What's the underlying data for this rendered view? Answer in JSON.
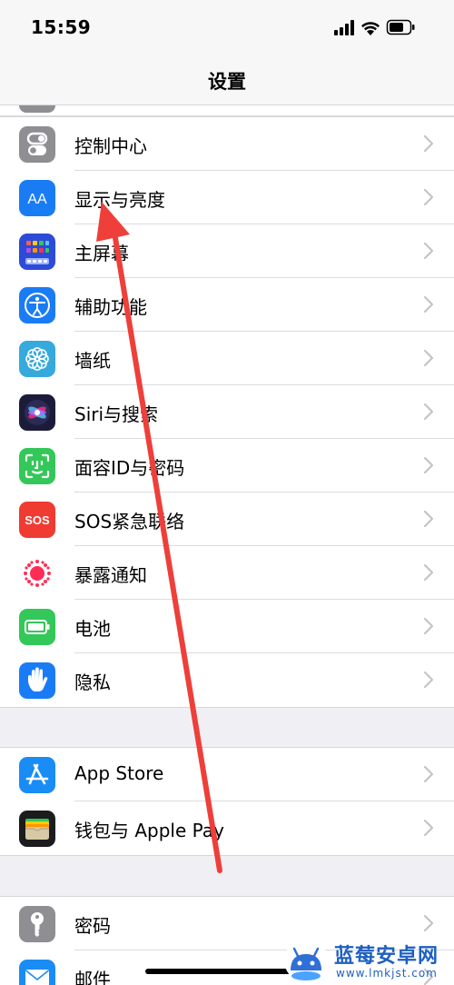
{
  "status_bar": {
    "time": "15:59",
    "icons": [
      "cellular-signal-icon",
      "wifi-icon",
      "battery-icon"
    ]
  },
  "nav": {
    "title": "设置"
  },
  "groups": [
    {
      "items": [
        {
          "label": "控制中心",
          "icon": "control-center-icon",
          "color": "#8e8e93"
        },
        {
          "label": "显示与亮度",
          "icon": "display-brightness-icon",
          "color": "#1a7cf5"
        },
        {
          "label": "主屏幕",
          "icon": "home-screen-icon",
          "color": "#2c4bd6"
        },
        {
          "label": "辅助功能",
          "icon": "accessibility-icon",
          "color": "#1a7cf5"
        },
        {
          "label": "墙纸",
          "icon": "wallpaper-icon",
          "color": "#36aadc"
        },
        {
          "label": "Siri与搜索",
          "icon": "siri-icon",
          "color": "#1c1c3a"
        },
        {
          "label": "面容ID与密码",
          "icon": "face-id-icon",
          "color": "#34c759"
        },
        {
          "label": "SOS紧急联络",
          "icon": "sos-icon",
          "color": "#ef3b32"
        },
        {
          "label": "暴露通知",
          "icon": "exposure-notification-icon",
          "color": "#ff2d55"
        },
        {
          "label": "电池",
          "icon": "battery-settings-icon",
          "color": "#34c759"
        },
        {
          "label": "隐私",
          "icon": "privacy-hand-icon",
          "color": "#1a7cf5"
        }
      ]
    },
    {
      "items": [
        {
          "label": "App Store",
          "icon": "app-store-icon",
          "color": "#1a8cf5"
        },
        {
          "label": "钱包与 Apple Pay",
          "icon": "wallet-icon",
          "color": "#1c1c1e"
        }
      ]
    },
    {
      "items": [
        {
          "label": "密码",
          "icon": "passwords-key-icon",
          "color": "#8e8e93"
        },
        {
          "label": "邮件",
          "icon": "mail-icon",
          "color": "#1a8cf5"
        }
      ]
    }
  ],
  "annotation": {
    "arrow_color": "#ee3f3a"
  },
  "watermark": {
    "title": "蓝莓安卓网",
    "url": "www.lmkjst.com",
    "color": "#1e5fbf"
  }
}
